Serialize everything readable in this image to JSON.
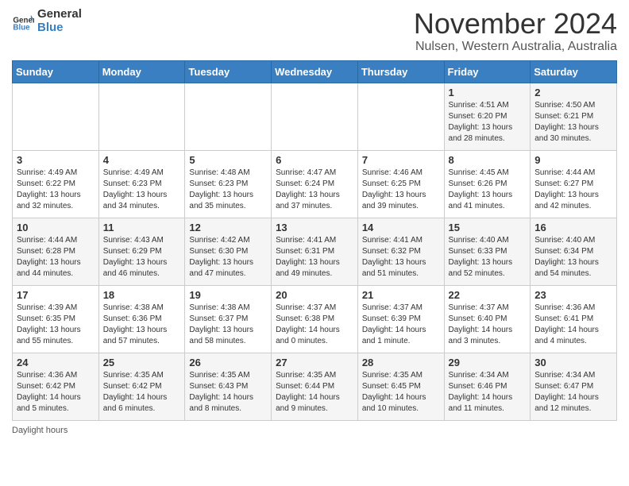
{
  "header": {
    "logo_general": "General",
    "logo_blue": "Blue",
    "title": "November 2024",
    "subtitle": "Nulsen, Western Australia, Australia"
  },
  "days_of_week": [
    "Sunday",
    "Monday",
    "Tuesday",
    "Wednesday",
    "Thursday",
    "Friday",
    "Saturday"
  ],
  "weeks": [
    [
      {
        "day": "",
        "info": ""
      },
      {
        "day": "",
        "info": ""
      },
      {
        "day": "",
        "info": ""
      },
      {
        "day": "",
        "info": ""
      },
      {
        "day": "",
        "info": ""
      },
      {
        "day": "1",
        "info": "Sunrise: 4:51 AM\nSunset: 6:20 PM\nDaylight: 13 hours and 28 minutes."
      },
      {
        "day": "2",
        "info": "Sunrise: 4:50 AM\nSunset: 6:21 PM\nDaylight: 13 hours and 30 minutes."
      }
    ],
    [
      {
        "day": "3",
        "info": "Sunrise: 4:49 AM\nSunset: 6:22 PM\nDaylight: 13 hours and 32 minutes."
      },
      {
        "day": "4",
        "info": "Sunrise: 4:49 AM\nSunset: 6:23 PM\nDaylight: 13 hours and 34 minutes."
      },
      {
        "day": "5",
        "info": "Sunrise: 4:48 AM\nSunset: 6:23 PM\nDaylight: 13 hours and 35 minutes."
      },
      {
        "day": "6",
        "info": "Sunrise: 4:47 AM\nSunset: 6:24 PM\nDaylight: 13 hours and 37 minutes."
      },
      {
        "day": "7",
        "info": "Sunrise: 4:46 AM\nSunset: 6:25 PM\nDaylight: 13 hours and 39 minutes."
      },
      {
        "day": "8",
        "info": "Sunrise: 4:45 AM\nSunset: 6:26 PM\nDaylight: 13 hours and 41 minutes."
      },
      {
        "day": "9",
        "info": "Sunrise: 4:44 AM\nSunset: 6:27 PM\nDaylight: 13 hours and 42 minutes."
      }
    ],
    [
      {
        "day": "10",
        "info": "Sunrise: 4:44 AM\nSunset: 6:28 PM\nDaylight: 13 hours and 44 minutes."
      },
      {
        "day": "11",
        "info": "Sunrise: 4:43 AM\nSunset: 6:29 PM\nDaylight: 13 hours and 46 minutes."
      },
      {
        "day": "12",
        "info": "Sunrise: 4:42 AM\nSunset: 6:30 PM\nDaylight: 13 hours and 47 minutes."
      },
      {
        "day": "13",
        "info": "Sunrise: 4:41 AM\nSunset: 6:31 PM\nDaylight: 13 hours and 49 minutes."
      },
      {
        "day": "14",
        "info": "Sunrise: 4:41 AM\nSunset: 6:32 PM\nDaylight: 13 hours and 51 minutes."
      },
      {
        "day": "15",
        "info": "Sunrise: 4:40 AM\nSunset: 6:33 PM\nDaylight: 13 hours and 52 minutes."
      },
      {
        "day": "16",
        "info": "Sunrise: 4:40 AM\nSunset: 6:34 PM\nDaylight: 13 hours and 54 minutes."
      }
    ],
    [
      {
        "day": "17",
        "info": "Sunrise: 4:39 AM\nSunset: 6:35 PM\nDaylight: 13 hours and 55 minutes."
      },
      {
        "day": "18",
        "info": "Sunrise: 4:38 AM\nSunset: 6:36 PM\nDaylight: 13 hours and 57 minutes."
      },
      {
        "day": "19",
        "info": "Sunrise: 4:38 AM\nSunset: 6:37 PM\nDaylight: 13 hours and 58 minutes."
      },
      {
        "day": "20",
        "info": "Sunrise: 4:37 AM\nSunset: 6:38 PM\nDaylight: 14 hours and 0 minutes."
      },
      {
        "day": "21",
        "info": "Sunrise: 4:37 AM\nSunset: 6:39 PM\nDaylight: 14 hours and 1 minute."
      },
      {
        "day": "22",
        "info": "Sunrise: 4:37 AM\nSunset: 6:40 PM\nDaylight: 14 hours and 3 minutes."
      },
      {
        "day": "23",
        "info": "Sunrise: 4:36 AM\nSunset: 6:41 PM\nDaylight: 14 hours and 4 minutes."
      }
    ],
    [
      {
        "day": "24",
        "info": "Sunrise: 4:36 AM\nSunset: 6:42 PM\nDaylight: 14 hours and 5 minutes."
      },
      {
        "day": "25",
        "info": "Sunrise: 4:35 AM\nSunset: 6:42 PM\nDaylight: 14 hours and 6 minutes."
      },
      {
        "day": "26",
        "info": "Sunrise: 4:35 AM\nSunset: 6:43 PM\nDaylight: 14 hours and 8 minutes."
      },
      {
        "day": "27",
        "info": "Sunrise: 4:35 AM\nSunset: 6:44 PM\nDaylight: 14 hours and 9 minutes."
      },
      {
        "day": "28",
        "info": "Sunrise: 4:35 AM\nSunset: 6:45 PM\nDaylight: 14 hours and 10 minutes."
      },
      {
        "day": "29",
        "info": "Sunrise: 4:34 AM\nSunset: 6:46 PM\nDaylight: 14 hours and 11 minutes."
      },
      {
        "day": "30",
        "info": "Sunrise: 4:34 AM\nSunset: 6:47 PM\nDaylight: 14 hours and 12 minutes."
      }
    ]
  ],
  "footer": "Daylight hours"
}
